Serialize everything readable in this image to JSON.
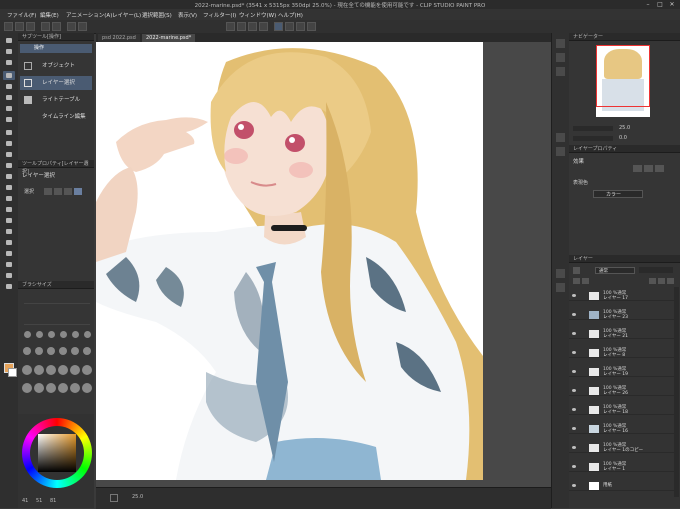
{
  "window": {
    "title": "2022-marine.psd* (3541 x 5315px 350dpi 25.0%) - 現在全ての機能を使用可能です - CLIP STUDIO PAINT PRO",
    "min_symbol": "–",
    "max_symbol": "□",
    "close_symbol": "✕"
  },
  "menu": [
    "ファイル(F)",
    "編集(E)",
    "アニメーション(A)",
    "レイヤー(L)",
    "選択範囲(S)",
    "表示(V)",
    "フィルター(I)",
    "ウィンドウ(W)",
    "ヘルプ(H)"
  ],
  "subtool_panel": {
    "header": "サブツール[操作]",
    "group": "操作",
    "items": [
      "オブジェクト",
      "レイヤー選択",
      "ライトテーブル",
      "タイムライン編集"
    ],
    "selected_index": 1
  },
  "tool_property": {
    "header": "ツールプロパティ[レイヤー選択]",
    "title": "レイヤー選択",
    "label": "選択"
  },
  "brush_panel": {
    "header": "ブラシサイズ"
  },
  "canvas": {
    "tabs": [
      "psd 2022.psd",
      "2022-marine.psd*"
    ],
    "active_tab": 1,
    "zoom": "25.0"
  },
  "color_bar": {
    "values": [
      "41",
      "51",
      "81"
    ]
  },
  "navigator": {
    "header": "ナビゲーター",
    "zoom": "25.0",
    "angle": "0.0"
  },
  "layer_property": {
    "header": "レイヤープロパティ",
    "effect_label": "効果",
    "expression_label": "表現色",
    "expression_value": "カラー"
  },
  "layers": {
    "header": "レイヤー",
    "blend_mode": "通常",
    "rows": [
      {
        "pct": "100 %通常",
        "name": "レイヤー 17"
      },
      {
        "pct": "100 %通常",
        "name": "レイヤー 23"
      },
      {
        "pct": "100 %通常",
        "name": "レイヤー 21"
      },
      {
        "pct": "100 %通常",
        "name": "レイヤー 8"
      },
      {
        "pct": "100 %通常",
        "name": "レイヤー 19"
      },
      {
        "pct": "100 %通常",
        "name": "レイヤー 26"
      },
      {
        "pct": "100 %通常",
        "name": "レイヤー 18"
      },
      {
        "pct": "100 %通常",
        "name": "レイヤー 16"
      },
      {
        "pct": "100 %通常",
        "name": "レイヤー 1のコピー"
      },
      {
        "pct": "100 %通常",
        "name": "レイヤー 1"
      },
      {
        "pct": "",
        "name": "用紙"
      }
    ]
  },
  "colors": {
    "accent": "#4a5b72",
    "hair": "#e7c783",
    "shirt_shadow": "#4b6578",
    "tie": "#6f8fa8",
    "skin": "#f6e0d3",
    "eye": "#c2506a"
  }
}
